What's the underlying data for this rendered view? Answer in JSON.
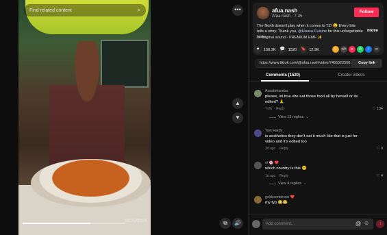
{
  "video": {
    "search_placeholder": "Find related content",
    "search_icon": "magnifier",
    "timestamp": "00:16/00:24",
    "progress_fraction": 0.66
  },
  "controls": {
    "more_icon": "ellipsis",
    "prev_icon": "chevron-up",
    "next_icon": "chevron-down",
    "pip_icon": "picture-in-picture",
    "volume_icon": "speaker"
  },
  "author": {
    "username": "afua.nash",
    "subline": "Afua nash · 7-25",
    "follow_label": "Follow",
    "follow_color": "#fe2c55"
  },
  "post": {
    "caption_part1": "The North doesn't play when it comes to TZ! 😮 Every bite tells a story. Thank you, ",
    "caption_mention": "@Hausa Cuisine",
    "caption_part2": " for this unforgettable taste...",
    "more_label": "more",
    "music": "original sound - PREMIUM EMF ✨"
  },
  "stats": {
    "likes": "156.2K",
    "comments": "1520",
    "saves": "12.9K"
  },
  "share": {
    "url": "https://www.tiktok.com/@afua.nash/video/7466522566...",
    "copy_label": "Copy link"
  },
  "tabs": [
    {
      "label": "Comments (1520)",
      "active": true
    },
    {
      "label": "Creator videos",
      "active": false
    }
  ],
  "comments": [
    {
      "name": "Asaabrowmba",
      "text": "please, ist true she eat those food all by herself or its edited? 🙏",
      "date": "7-26",
      "reply": "Reply",
      "likes": "134",
      "replies": "View 13 replies"
    },
    {
      "name": "Tom Hardy",
      "text": "is aesthetics they don't eat it much like that is just for video and it's edited too",
      "date": "3d ago",
      "reply": "Reply",
      "likes": "0",
      "replies": ""
    },
    {
      "name": "ef 🌸 ❤️",
      "text": "which country is this 😊",
      "date": "1d ago",
      "reply": "Reply",
      "likes": "4",
      "replies": "View 4 replies"
    },
    {
      "name": "goldscentdrops ❤️",
      "text": "my fyp 😂😂",
      "date": "",
      "reply": "",
      "likes": "",
      "replies": ""
    }
  ],
  "composer": {
    "placeholder": "Add comment...",
    "at_icon": "@",
    "emoji_icon": "smiley"
  }
}
